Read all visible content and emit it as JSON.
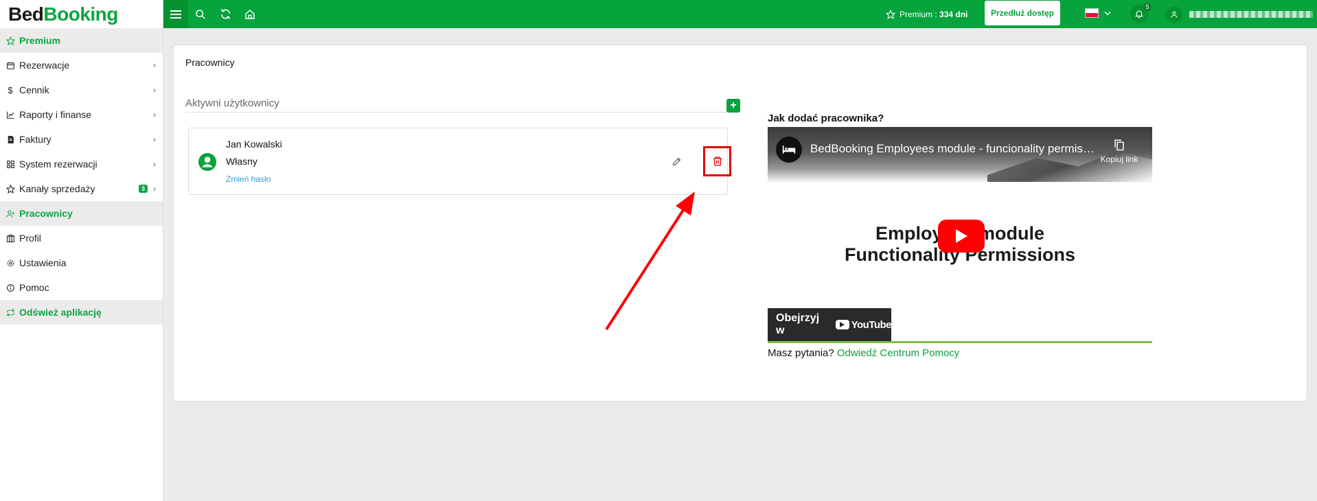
{
  "app": {
    "logo_bed": "Bed",
    "logo_booking": "Booking"
  },
  "sidebar": {
    "items": [
      {
        "label": "Premium",
        "icon": "star-icon",
        "active": true,
        "chevron": false
      },
      {
        "label": "Rezerwacje",
        "icon": "calendar-icon",
        "active": false,
        "chevron": true
      },
      {
        "label": "Cennik",
        "icon": "dollar-icon",
        "active": false,
        "chevron": true
      },
      {
        "label": "Raporty i finanse",
        "icon": "chart-icon",
        "active": false,
        "chevron": true
      },
      {
        "label": "Faktury",
        "icon": "invoice-icon",
        "active": false,
        "chevron": true
      },
      {
        "label": "System rezerwacji",
        "icon": "grid-icon",
        "active": false,
        "chevron": true
      },
      {
        "label": "Kanały sprzedaży",
        "icon": "star-icon",
        "active": false,
        "chevron": true,
        "badge": "3"
      },
      {
        "label": "Pracownicy",
        "icon": "user-plus-icon",
        "active": true,
        "chevron": false
      },
      {
        "label": "Profil",
        "icon": "building-icon",
        "active": false,
        "chevron": false
      },
      {
        "label": "Ustawienia",
        "icon": "gear-icon",
        "active": false,
        "chevron": false
      },
      {
        "label": "Pomoc",
        "icon": "info-icon",
        "active": false,
        "chevron": false
      },
      {
        "label": "Odśwież aplikację",
        "icon": "refresh-icon",
        "active": true,
        "chevron": false
      }
    ]
  },
  "topbar": {
    "premium_label": "Premium : ",
    "premium_days": "334 dni",
    "extend_label": "Przedłuż dostęp",
    "notifications_count": "5"
  },
  "main": {
    "title": "Pracownicy",
    "section_title": "Aktywni użytkownicy",
    "add_label": "+",
    "users": [
      {
        "name": "Jan Kowalski",
        "role": "Własny",
        "link": "Zmień hasło"
      }
    ],
    "help": {
      "title": "Jak dodać pracownika?",
      "video_title": "BedBooking Employees module - funcionality permissions",
      "copy_link": "Kopiuj link",
      "video_heading_1": "Employees module",
      "video_heading_2": "Functionality Permissions",
      "watch_on": "Obejrzyj w",
      "youtube": "YouTube",
      "footer_text": "Masz pytania? ",
      "footer_link": "Odwiedź Centrum Pomocy"
    }
  },
  "colors": {
    "brand_green": "#07a33d",
    "highlight_red": "#e00000",
    "link_blue": "#2a9fd6"
  }
}
